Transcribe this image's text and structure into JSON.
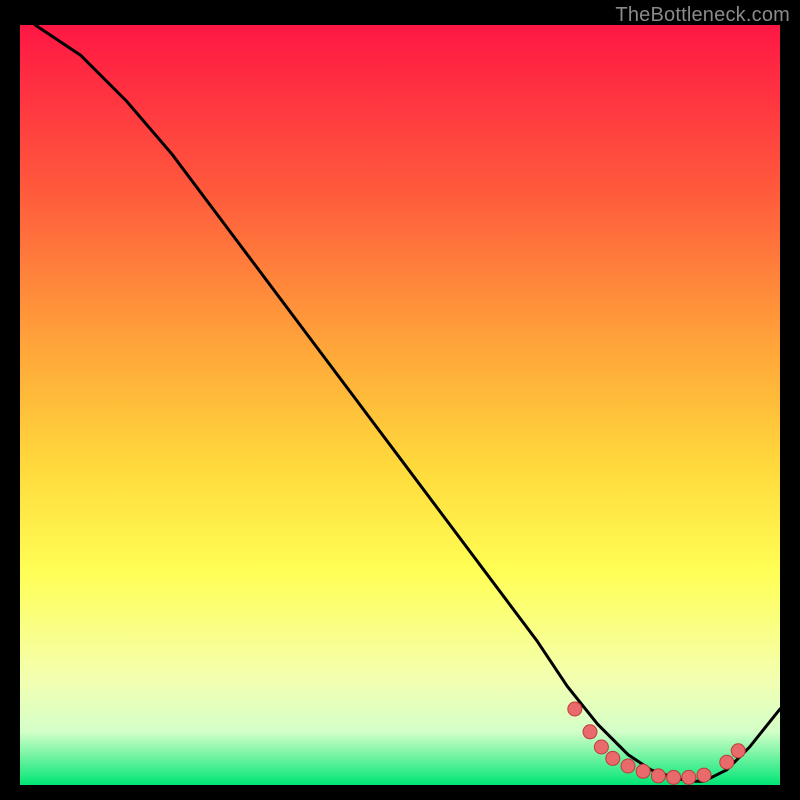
{
  "attribution": "TheBottleneck.com",
  "colors": {
    "black": "#000000",
    "curve": "#000000",
    "dot_fill": "#e96a6a",
    "dot_stroke": "#c23b3b",
    "grad_top": "#ff1744",
    "grad_mid1": "#ff5a3c",
    "grad_mid2": "#ffa43a",
    "grad_mid3": "#ffd93b",
    "grad_mid4": "#ffff55",
    "grad_mid5": "#f4ffb0",
    "grad_mid6": "#d3ffc8",
    "grad_bot": "#00e676"
  },
  "chart_data": {
    "type": "line",
    "title": "",
    "xlabel": "",
    "ylabel": "",
    "xlim": [
      0,
      100
    ],
    "ylim": [
      0,
      100
    ],
    "series": [
      {
        "name": "curve",
        "x": [
          2,
          8,
          14,
          20,
          26,
          32,
          38,
          44,
          50,
          56,
          62,
          68,
          72,
          76,
          80,
          83,
          86,
          88,
          90,
          93,
          96,
          100
        ],
        "y": [
          100,
          96,
          90,
          83,
          75,
          67,
          59,
          51,
          43,
          35,
          27,
          19,
          13,
          8,
          4,
          2,
          1,
          0.5,
          0.5,
          2,
          5,
          10
        ]
      }
    ],
    "markers": [
      {
        "x": 73,
        "y": 10
      },
      {
        "x": 75,
        "y": 7
      },
      {
        "x": 76.5,
        "y": 5
      },
      {
        "x": 78,
        "y": 3.5
      },
      {
        "x": 80,
        "y": 2.5
      },
      {
        "x": 82,
        "y": 1.8
      },
      {
        "x": 84,
        "y": 1.2
      },
      {
        "x": 86,
        "y": 1
      },
      {
        "x": 88,
        "y": 1
      },
      {
        "x": 90,
        "y": 1.3
      },
      {
        "x": 93,
        "y": 3
      },
      {
        "x": 94.5,
        "y": 4.5
      }
    ]
  }
}
